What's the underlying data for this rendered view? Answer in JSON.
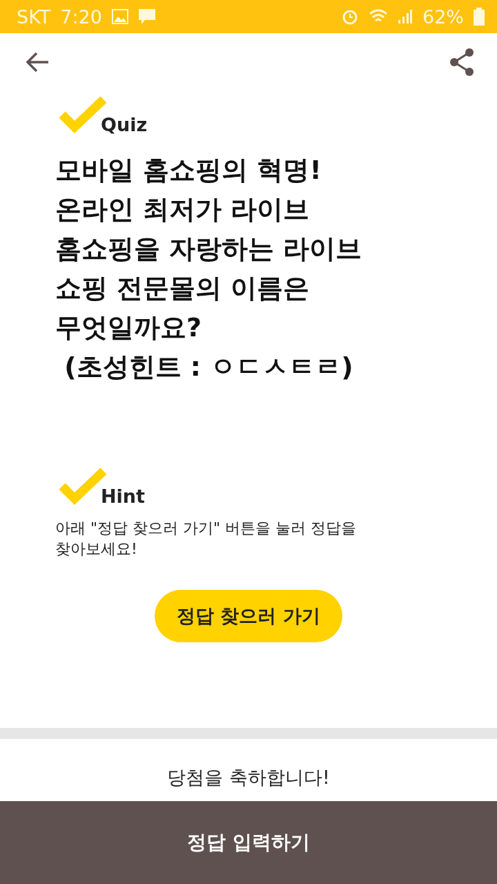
{
  "status_bar": {
    "carrier": "SKT",
    "time": "7:20",
    "battery": "62%"
  },
  "quiz": {
    "label": "Quiz",
    "question": "모바일 홈쇼핑의 혁명!\n온라인 최저가 라이브\n홈쇼핑을 자랑하는 라이브\n쇼핑 전문몰의 이름은\n무엇일까요?\n (초성힌트 : ㅇㄷㅅㅌㄹ)"
  },
  "hint": {
    "label": "Hint",
    "text": "아래 \"정답 찾으러 가기\" 버튼을 눌러 정답을\n찾아보세요!",
    "button": "정답 찾으러 가기"
  },
  "result": {
    "text": "당첨을 축하합니다!"
  },
  "bottom_button": "정답 입력하기"
}
